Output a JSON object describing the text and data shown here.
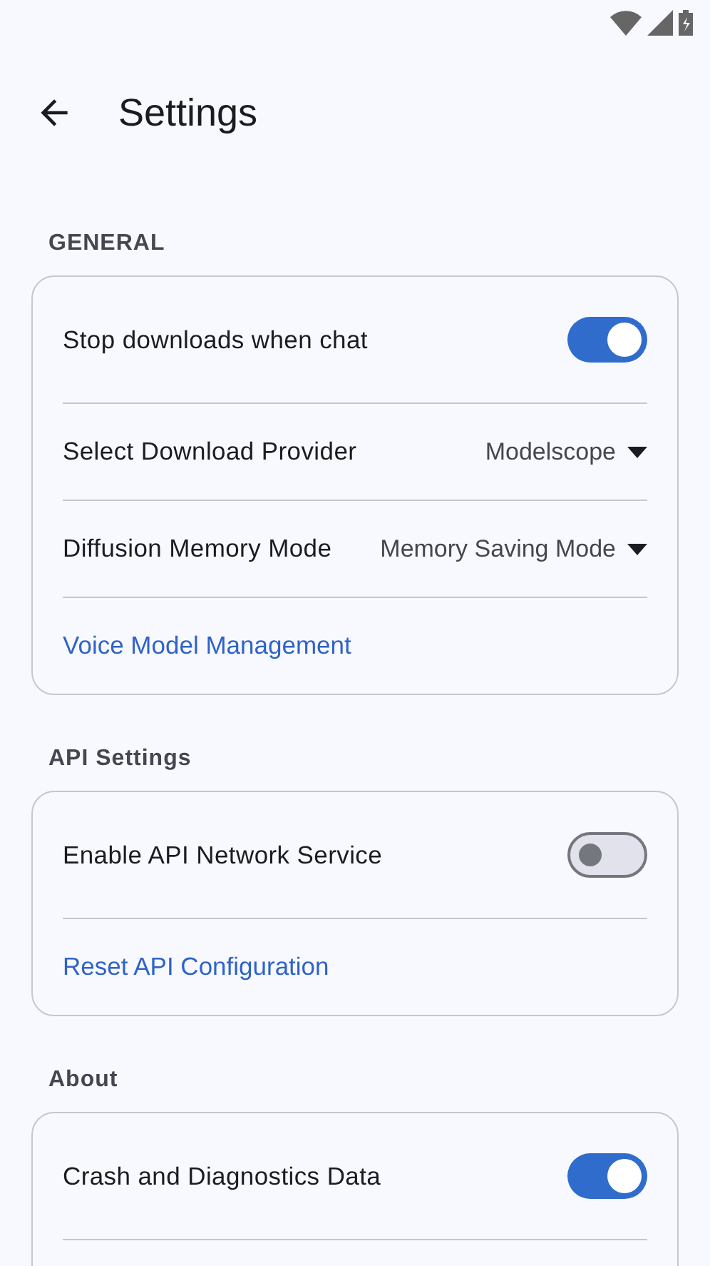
{
  "app_bar": {
    "title": "Settings"
  },
  "sections": [
    {
      "title": "GENERAL",
      "items": [
        {
          "kind": "toggle",
          "label": "Stop downloads when chat",
          "on": true
        },
        {
          "kind": "dropdown",
          "label": "Select Download Provider",
          "value": "Modelscope"
        },
        {
          "kind": "dropdown",
          "label": "Diffusion Memory Mode",
          "value": "Memory Saving Mode"
        },
        {
          "kind": "link",
          "label": "Voice Model Management"
        }
      ]
    },
    {
      "title": "API Settings",
      "items": [
        {
          "kind": "toggle",
          "label": "Enable API Network Service",
          "on": false
        },
        {
          "kind": "link",
          "label": "Reset API Configuration"
        }
      ]
    },
    {
      "title": "About",
      "items": [
        {
          "kind": "toggle",
          "label": "Crash and Diagnostics Data",
          "on": true
        },
        {
          "kind": "cut"
        }
      ]
    }
  ]
}
